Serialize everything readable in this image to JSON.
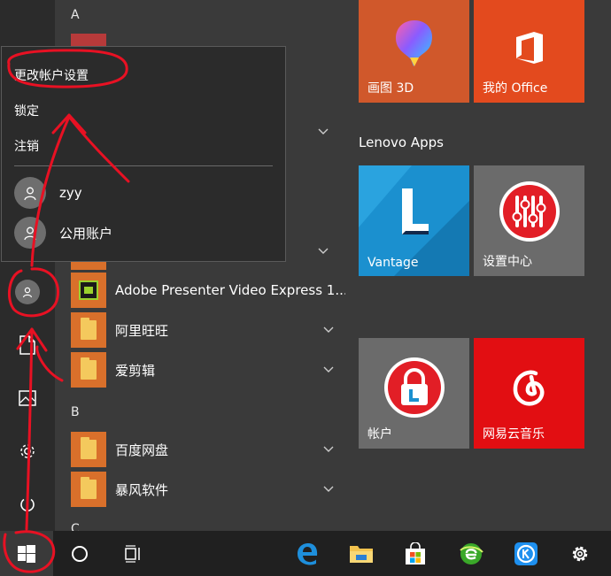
{
  "applist": {
    "letters": [
      "A",
      "B",
      "C"
    ],
    "apps": [
      {
        "label": "Adobe Presenter Video Express 1...",
        "icon": "adobe-presenter-icon"
      },
      {
        "label": "阿里旺旺",
        "icon": "folder-icon"
      },
      {
        "label": "爱剪辑",
        "icon": "folder-icon"
      },
      {
        "label": "百度网盘",
        "icon": "folder-icon"
      },
      {
        "label": "暴风软件",
        "icon": "folder-icon"
      }
    ]
  },
  "account_menu": {
    "change_settings": "更改帐户设置",
    "lock": "锁定",
    "sign_out": "注销",
    "users": [
      {
        "name": "zyy",
        "icon": "user-avatar-icon"
      },
      {
        "name": "公用账户",
        "icon": "user-avatar-icon"
      }
    ]
  },
  "tiles": {
    "group_title": "Lenovo Apps",
    "items": [
      {
        "label": "画图 3D",
        "icon": "paint3d-icon",
        "color": "#d0582b"
      },
      {
        "label": "我的 Office",
        "icon": "office-icon",
        "color": "#e34a1e"
      },
      {
        "label": "Vantage",
        "icon": "vantage-icon",
        "color": "#1b90cf"
      },
      {
        "label": "设置中心",
        "icon": "settings-center-icon",
        "color": "#6b6b6b"
      },
      {
        "label": "帐户",
        "icon": "account-lock-icon",
        "color": "#6b6b6b"
      },
      {
        "label": "网易云音乐",
        "icon": "netease-music-icon",
        "color": "#e20e12"
      }
    ]
  },
  "rail_icons": [
    "user-avatar-icon",
    "document-icon",
    "pictures-icon",
    "gear-icon",
    "power-icon"
  ],
  "taskbar_icons": [
    "windows-start-icon",
    "cortana-icon",
    "task-view-icon",
    "edge-icon",
    "file-explorer-icon",
    "store-icon",
    "green-browser-icon",
    "kugou-icon",
    "settings-gear-icon"
  ],
  "colors": {
    "accent_red": "#e81123",
    "tile_orange": "#d9702b"
  }
}
